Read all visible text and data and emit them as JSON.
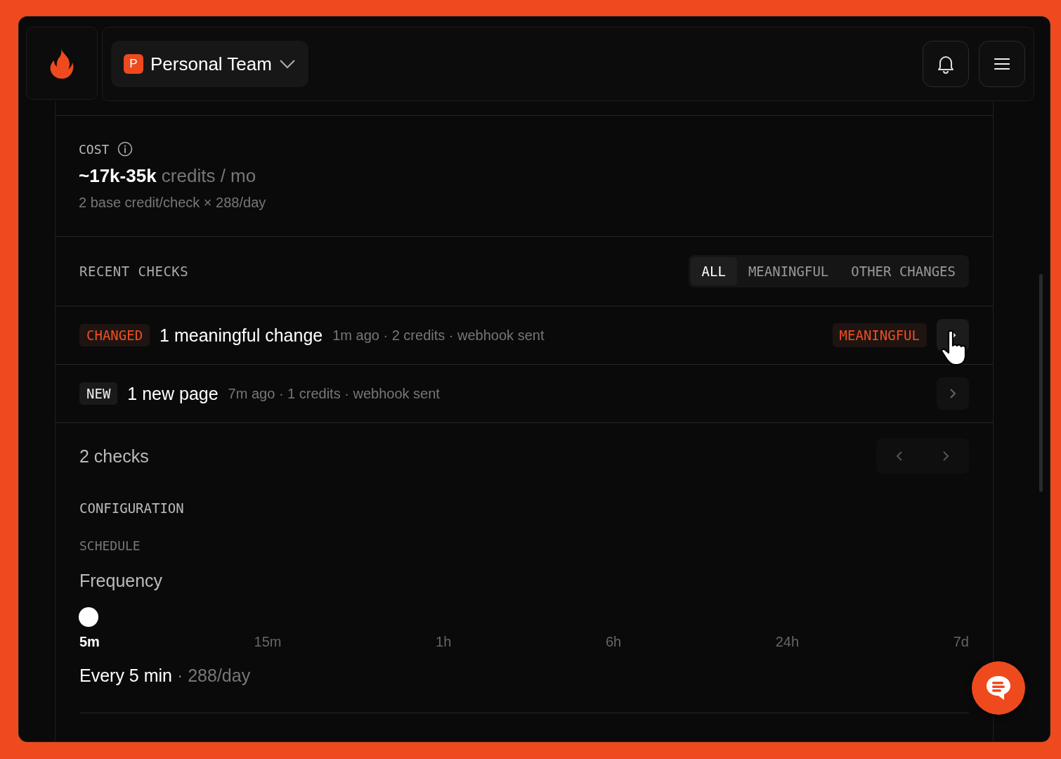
{
  "header": {
    "team": {
      "initial": "P",
      "name": "Personal Team"
    }
  },
  "cost": {
    "label": "COST",
    "amount": "~17k-35k",
    "unit": "credits / mo",
    "formula": "2 base credit/check × 288/day"
  },
  "recent_checks": {
    "title": "RECENT CHECKS",
    "filters": [
      {
        "label": "ALL",
        "selected": true
      },
      {
        "label": "MEANINGFUL",
        "selected": false
      },
      {
        "label": "OTHER CHANGES",
        "selected": false
      }
    ],
    "rows": [
      {
        "kind": "changed",
        "badge": "CHANGED",
        "title": "1 meaningful change",
        "meta": "1m ago · 2 credits · webhook sent",
        "tag": "MEANINGFUL",
        "hovered": true
      },
      {
        "kind": "new",
        "badge": "NEW",
        "title": "1 new page",
        "meta": "7m ago · 1 credits · webhook sent",
        "hovered": false
      }
    ],
    "count": "2 checks",
    "pagination": {
      "prev_disabled": true,
      "next_disabled": true
    }
  },
  "configuration": {
    "title": "CONFIGURATION",
    "section": "SCHEDULE",
    "field": "Frequency",
    "slider": {
      "level": 0,
      "stops": [
        {
          "label": "5m",
          "selected": true
        },
        {
          "label": "15m",
          "selected": false
        },
        {
          "label": "1h",
          "selected": false
        },
        {
          "label": "6h",
          "selected": false
        },
        {
          "label": "24h",
          "selected": false
        },
        {
          "label": "7d",
          "selected": false
        }
      ]
    },
    "summary": "Every 5 min",
    "summary_detail": "· 288/day"
  }
}
